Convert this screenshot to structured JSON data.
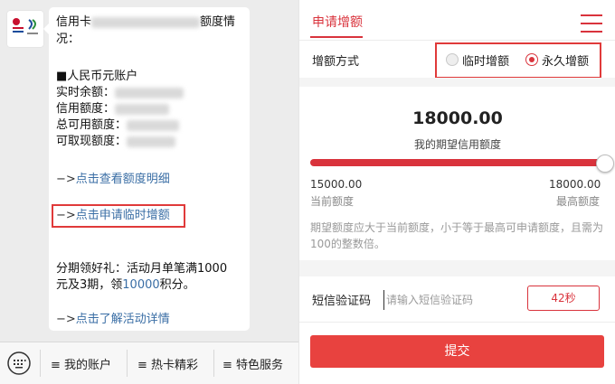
{
  "chat": {
    "lines": {
      "l1a": "信用卡",
      "l1b": "额度情",
      "l2": "况：",
      "l3": "■人民币元账户",
      "l4": "实时余额：",
      "l5": "信用额度：",
      "l6": "总可用额度：",
      "l7": "可取现额度：",
      "link1_arrow": "−>",
      "link1": "点击查看额度明细",
      "link2_arrow": "−>",
      "link2": "点击申请临时增额",
      "l10": "分期领好礼：活动月单笔满1000",
      "l11a": "元及3期，领",
      "l11b": "10000",
      "l11c": "积分。",
      "link3_arrow": "−>",
      "link3": "点击了解活动详情"
    },
    "menu": {
      "item1": "≡ 我的账户",
      "item2": "≡ 热卡精彩",
      "item3": "≡ 特色服务"
    }
  },
  "form": {
    "tab_title": "申请增额",
    "method_label": "增额方式",
    "option_temp": "临时增额",
    "option_perm": "永久增额",
    "selected_option": "永久增额",
    "amount": "18000.00",
    "amount_caption": "我的期望信用额度",
    "slider_fraction": 1.0,
    "current_value": "15000.00",
    "current_label": "当前额度",
    "max_value": "18000.00",
    "max_label": "最高额度",
    "hint": "期望额度应大于当前额度，小于等于最高可申请额度，且需为100的整数倍。",
    "sms_label": "短信验证码",
    "sms_placeholder": "请输入短信验证码",
    "countdown": "42秒",
    "submit": "提交"
  },
  "colors": {
    "accent": "#d9333c",
    "highlight": "#e03a3a",
    "submit_bg": "#e8423f"
  },
  "icons": [
    "bank-logo-icon",
    "keyboard-icon",
    "hamburger-menu-icon"
  ]
}
